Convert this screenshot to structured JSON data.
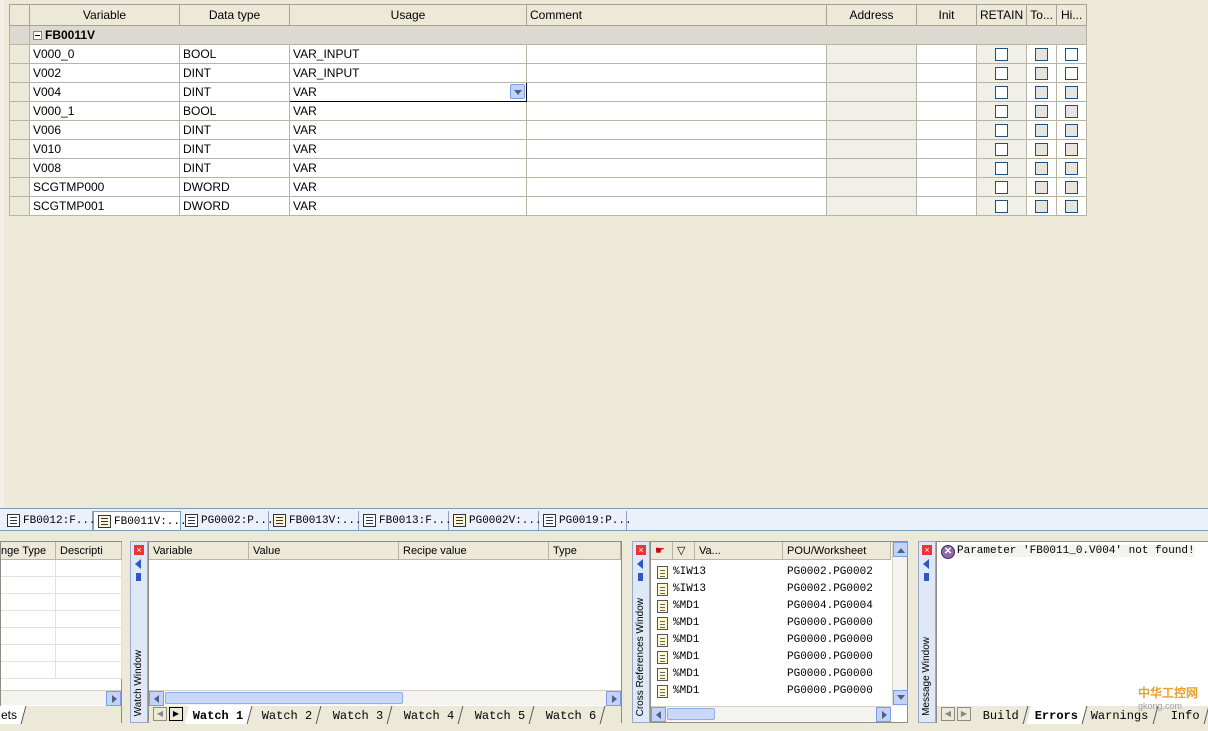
{
  "var_table": {
    "columns": [
      "Variable",
      "Data type",
      "Usage",
      "Comment",
      "Address",
      "Init",
      "RETAIN",
      "To...",
      "Hi..."
    ],
    "group": "FB0011V",
    "rows": [
      {
        "variable": "V000_0",
        "datatype": "BOOL",
        "usage": "VAR_INPUT",
        "comment": "",
        "address": "",
        "init": ""
      },
      {
        "variable": "V002",
        "datatype": "DINT",
        "usage": "VAR_INPUT",
        "comment": "",
        "address": "",
        "init": ""
      },
      {
        "variable": "V004",
        "datatype": "DINT",
        "usage": "VAR",
        "comment": "",
        "address": "",
        "init": ""
      },
      {
        "variable": "V000_1",
        "datatype": "BOOL",
        "usage": "VAR",
        "comment": "",
        "address": "",
        "init": ""
      },
      {
        "variable": "V006",
        "datatype": "DINT",
        "usage": "VAR",
        "comment": "",
        "address": "",
        "init": ""
      },
      {
        "variable": "V010",
        "datatype": "DINT",
        "usage": "VAR",
        "comment": "",
        "address": "",
        "init": ""
      },
      {
        "variable": "V008",
        "datatype": "DINT",
        "usage": "VAR",
        "comment": "",
        "address": "",
        "init": ""
      },
      {
        "variable": "SCGTMP000",
        "datatype": "DWORD",
        "usage": "VAR",
        "comment": "",
        "address": "",
        "init": ""
      },
      {
        "variable": "SCGTMP001",
        "datatype": "DWORD",
        "usage": "VAR",
        "comment": "",
        "address": "",
        "init": ""
      }
    ],
    "selected_row_index": 2
  },
  "editor_tabs": [
    "FB0012:F...",
    "FB0011V:...",
    "PG0002:P...",
    "FB0013V:...",
    "FB0013:F...",
    "PG0002V:...",
    "PG0019:P..."
  ],
  "active_editor_tab": 1,
  "left_pane": {
    "columns": [
      "nge Type",
      "Descripti"
    ],
    "tab": "ets"
  },
  "watch_window": {
    "title": "Watch Window",
    "columns": [
      "Variable",
      "Value",
      "Recipe value",
      "Type"
    ],
    "tabs": [
      "Watch 1",
      "Watch 2",
      "Watch 3",
      "Watch 4",
      "Watch 5",
      "Watch 6"
    ],
    "active_tab": 0
  },
  "xref_window": {
    "title": "Cross References Window",
    "columns": [
      "Va...",
      "POU/Worksheet"
    ],
    "rows": [
      {
        "var": "%IW13",
        "pou": "PG0002.PG0002"
      },
      {
        "var": "%IW13",
        "pou": "PG0002.PG0002"
      },
      {
        "var": "%MD1",
        "pou": "PG0004.PG0004"
      },
      {
        "var": "%MD1",
        "pou": "PG0000.PG0000"
      },
      {
        "var": "%MD1",
        "pou": "PG0000.PG0000"
      },
      {
        "var": "%MD1",
        "pou": "PG0000.PG0000"
      },
      {
        "var": "%MD1",
        "pou": "PG0000.PG0000"
      },
      {
        "var": "%MD1",
        "pou": "PG0000.PG0000"
      }
    ]
  },
  "message_window": {
    "title": "Message Window",
    "message": "Parameter 'FB0011_0.V004' not found!",
    "tabs": [
      "Build",
      "Errors",
      "Warnings",
      "Info"
    ],
    "active_tab": 1
  },
  "watermark": {
    "text": "中华工控网",
    "sub": "gkong.com"
  },
  "colors": {
    "tab_bar": "#ecf0fb",
    "panel": "#ece9d8",
    "accent": "#2d59c4"
  }
}
